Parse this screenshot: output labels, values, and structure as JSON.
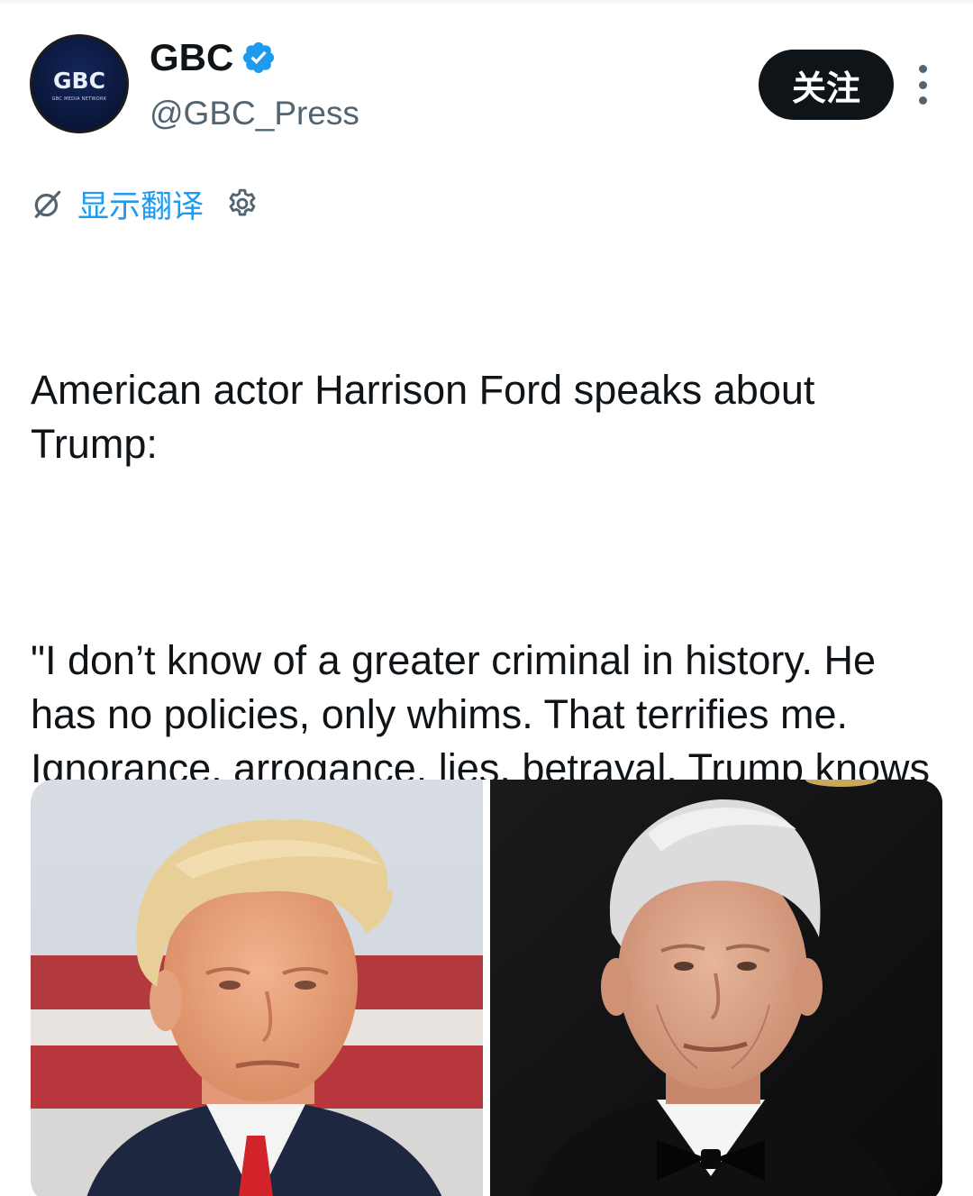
{
  "account": {
    "avatar_text": "GBC",
    "avatar_tagline": "GBC MEDIA NETWORK",
    "display_name": "GBC",
    "handle": "@GBC_Press",
    "verified": true
  },
  "actions": {
    "follow_label": "关注",
    "more_icon": "more-vertical-icon"
  },
  "translate": {
    "icon": "translate-icon",
    "label": "显示翻译",
    "settings_icon": "gear-icon"
  },
  "tweet": {
    "intro": "American actor Harrison Ford speaks about Trump:",
    "quote": "\"I don’t know of a greater criminal in history. He has no policies, only whims. That terrifies me. Ignorance, arrogance, lies, betrayal. Trump knows what he is doing... He is amassing a fortune while the world is going to hell.\""
  },
  "colors": {
    "accent": "#1d9bf0",
    "text": "#0f1419",
    "secondary": "#536471",
    "button_bg": "#0f1419"
  }
}
